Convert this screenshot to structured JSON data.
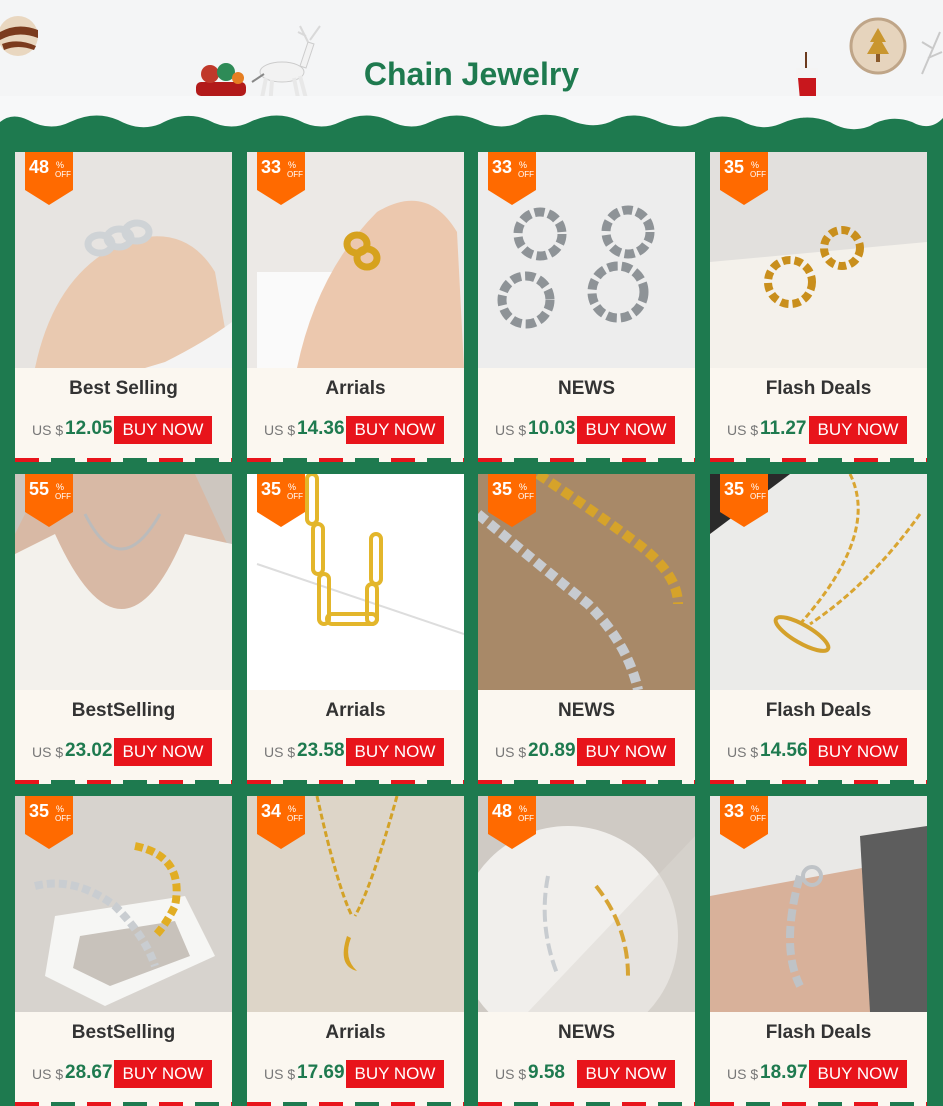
{
  "header": {
    "title": "Chain Jewelry"
  },
  "colors": {
    "brand_green": "#1e7a4f",
    "sale_orange": "#ff6a00",
    "buy_red": "#e8141b",
    "card_bg": "#fbf7f0"
  },
  "products": [
    {
      "discount": "48",
      "pct": "%",
      "off": "OFF",
      "category": "Best Selling",
      "currency": "US $",
      "price": "12.05",
      "buy": "BUY NOW",
      "image": "silver-chain-ring"
    },
    {
      "discount": "33",
      "pct": "%",
      "off": "OFF",
      "category": "Arrials",
      "currency": "US $",
      "price": "14.36",
      "buy": "BUY NOW",
      "image": "gold-chain-ring"
    },
    {
      "discount": "33",
      "pct": "%",
      "off": "OFF",
      "category": "NEWS",
      "currency": "US $",
      "price": "10.03",
      "buy": "BUY NOW",
      "image": "silver-hoop-earrings"
    },
    {
      "discount": "35",
      "pct": "%",
      "off": "OFF",
      "category": "Flash Deals",
      "currency": "US $",
      "price": "11.27",
      "buy": "BUY NOW",
      "image": "gold-hoop-earrings"
    },
    {
      "discount": "55",
      "pct": "%",
      "off": "OFF",
      "category": "BestSelling",
      "currency": "US $",
      "price": "23.02",
      "buy": "BUY NOW",
      "image": "silver-necklace-model"
    },
    {
      "discount": "35",
      "pct": "%",
      "off": "OFF",
      "category": "Arrials",
      "currency": "US $",
      "price": "23.58",
      "buy": "BUY NOW",
      "image": "gold-link-chain"
    },
    {
      "discount": "35",
      "pct": "%",
      "off": "OFF",
      "category": "NEWS",
      "currency": "US $",
      "price": "20.89",
      "buy": "BUY NOW",
      "image": "mixed-chain-necklaces"
    },
    {
      "discount": "35",
      "pct": "%",
      "off": "OFF",
      "category": "Flash Deals",
      "currency": "US $",
      "price": "14.56",
      "buy": "BUY NOW",
      "image": "gold-pin-necklace"
    },
    {
      "discount": "35",
      "pct": "%",
      "off": "OFF",
      "category": "BestSelling",
      "currency": "US $",
      "price": "28.67",
      "buy": "BUY NOW",
      "image": "chain-bracelets-box"
    },
    {
      "discount": "34",
      "pct": "%",
      "off": "OFF",
      "category": "Arrials",
      "currency": "US $",
      "price": "17.69",
      "buy": "BUY NOW",
      "image": "gold-moon-pendant"
    },
    {
      "discount": "48",
      "pct": "%",
      "off": "OFF",
      "category": "NEWS",
      "currency": "US $",
      "price": "9.58",
      "buy": "BUY NOW",
      "image": "link-bracelets-plate"
    },
    {
      "discount": "33",
      "pct": "%",
      "off": "OFF",
      "category": "Flash Deals",
      "currency": "US $",
      "price": "18.97",
      "buy": "BUY NOW",
      "image": "toggle-bracelet-wrist"
    }
  ]
}
